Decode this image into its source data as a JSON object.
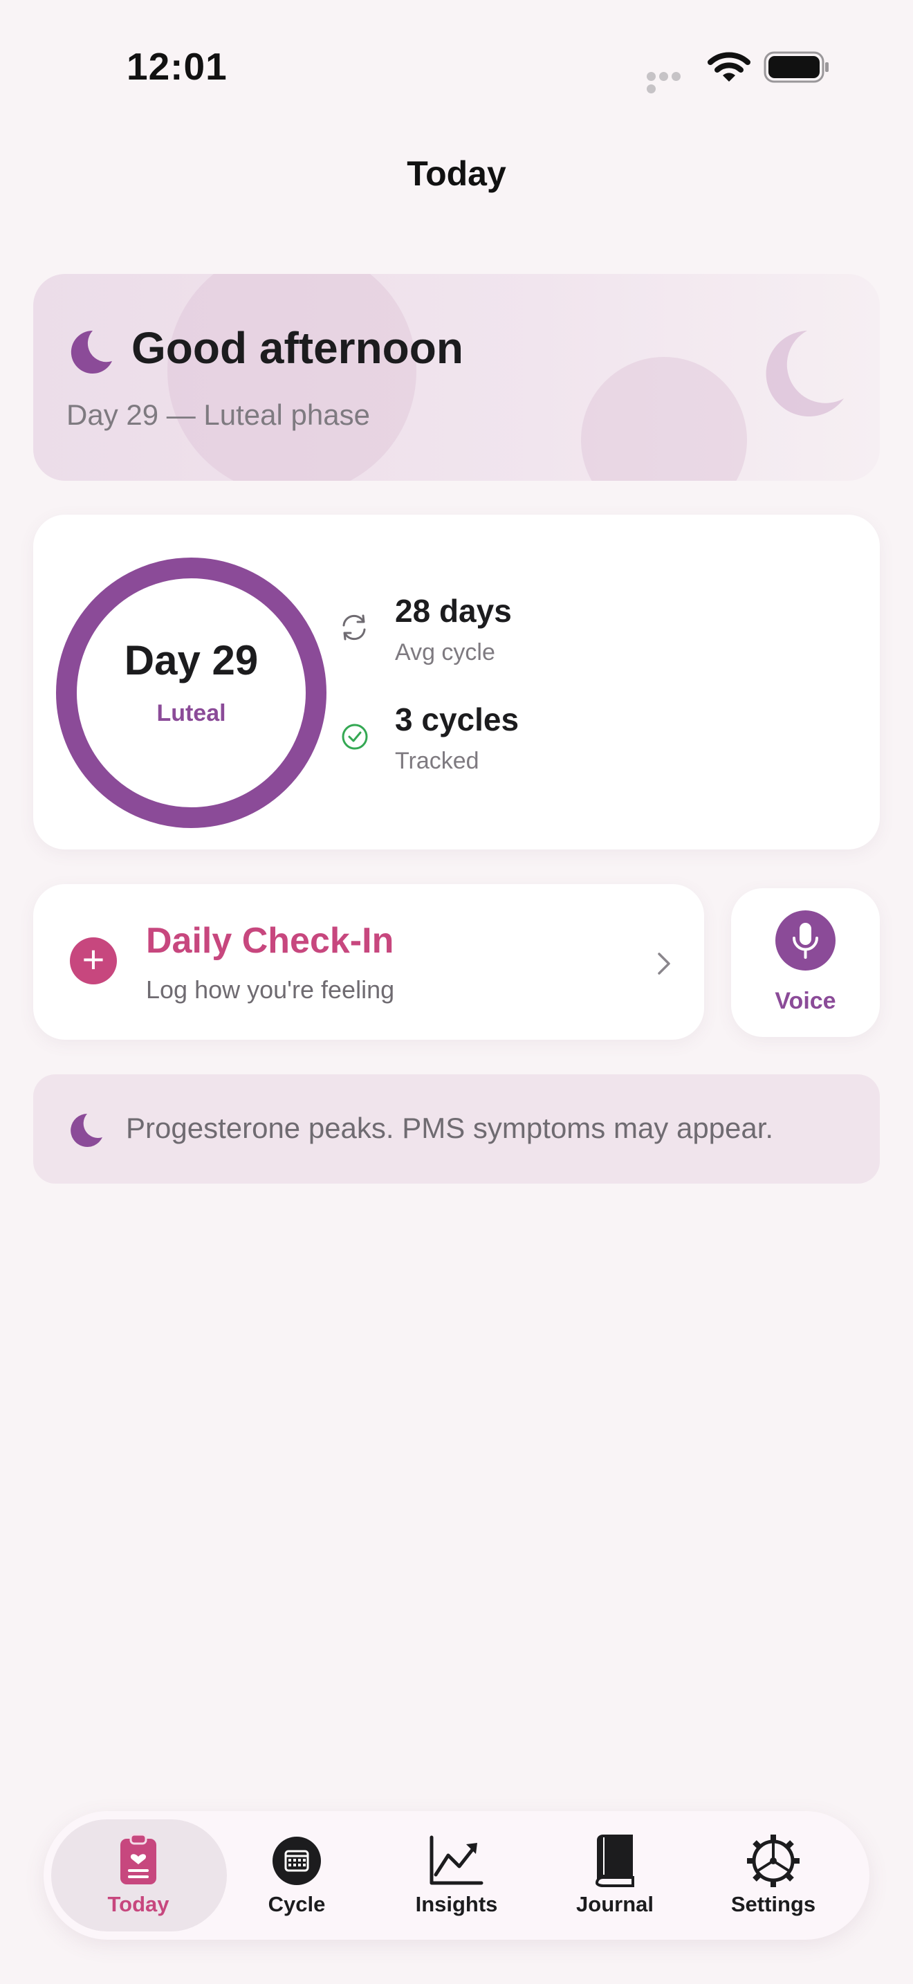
{
  "status_bar": {
    "time": "12:01"
  },
  "nav": {
    "title": "Today"
  },
  "greeting": {
    "title": "Good afternoon",
    "subtitle": "Day 29 — Luteal phase"
  },
  "cycle": {
    "day": "Day 29",
    "phase": "Luteal",
    "stats": [
      {
        "value": "28 days",
        "label": "Avg cycle",
        "icon": "refresh-icon"
      },
      {
        "value": "3 cycles",
        "label": "Tracked",
        "icon": "check-circle-icon"
      }
    ]
  },
  "checkin": {
    "title": "Daily Check-In",
    "subtitle": "Log how you're feeling"
  },
  "voice": {
    "label": "Voice"
  },
  "tip": {
    "text": "Progesterone peaks. PMS symptoms may appear."
  },
  "tabs": [
    {
      "label": "Today",
      "icon": "clipboard-heart-icon",
      "selected": true
    },
    {
      "label": "Cycle",
      "icon": "calendar-icon",
      "selected": false
    },
    {
      "label": "Insights",
      "icon": "chart-line-icon",
      "selected": false
    },
    {
      "label": "Journal",
      "icon": "book-icon",
      "selected": false
    },
    {
      "label": "Settings",
      "icon": "gear-icon",
      "selected": false
    }
  ],
  "colors": {
    "accent_purple": "#8b4b98",
    "accent_pink": "#c7477e",
    "success_green": "#34a853",
    "background": "#f9f4f6"
  }
}
